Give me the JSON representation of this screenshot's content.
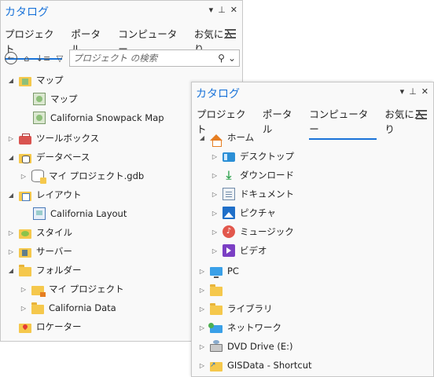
{
  "paneA": {
    "title": "カタログ",
    "header_icons": [
      "▾",
      "📌",
      "✕"
    ],
    "tabs": [
      {
        "label": "プロジェクト",
        "active": true
      },
      {
        "label": "ポータル",
        "active": false
      },
      {
        "label": "コンピューター",
        "active": false
      },
      {
        "label": "お気に入り",
        "active": false
      }
    ],
    "search": {
      "placeholder": "プロジェクト の検索"
    },
    "tree": [
      {
        "label": "マップ",
        "icon": "map-folder-icon",
        "expanded": true,
        "children": [
          {
            "label": "マップ",
            "icon": "map-icon"
          },
          {
            "label": "California Snowpack Map",
            "icon": "map-icon"
          }
        ]
      },
      {
        "label": "ツールボックス",
        "icon": "toolbox-icon",
        "expanded": false
      },
      {
        "label": "データベース",
        "icon": "database-folder-icon",
        "expanded": true,
        "children": [
          {
            "label": "マイ プロジェクト.gdb",
            "icon": "geodatabase-icon",
            "expandable": true
          }
        ]
      },
      {
        "label": "レイアウト",
        "icon": "layout-folder-icon",
        "expanded": true,
        "children": [
          {
            "label": "California Layout",
            "icon": "layout-icon"
          }
        ]
      },
      {
        "label": "スタイル",
        "icon": "style-folder-icon",
        "expanded": false
      },
      {
        "label": "サーバー",
        "icon": "server-folder-icon",
        "expanded": false
      },
      {
        "label": "フォルダー",
        "icon": "folder-icon",
        "expanded": true,
        "children": [
          {
            "label": "マイ プロジェクト",
            "icon": "home-folder-icon",
            "expandable": true
          },
          {
            "label": "California Data",
            "icon": "folder-icon",
            "expandable": true
          }
        ]
      },
      {
        "label": "ロケーター",
        "icon": "locator-folder-icon",
        "expanded": false
      }
    ]
  },
  "paneB": {
    "title": "カタログ",
    "header_icons": [
      "▾",
      "📌",
      "✕"
    ],
    "tabs": [
      {
        "label": "プロジェクト",
        "active": false
      },
      {
        "label": "ポータル",
        "active": false
      },
      {
        "label": "コンピューター",
        "active": true
      },
      {
        "label": "お気に入り",
        "active": false
      }
    ],
    "tree": [
      {
        "label": "ホーム",
        "icon": "home-icon",
        "expanded": true,
        "children": [
          {
            "label": "デスクトップ",
            "icon": "desktop-icon"
          },
          {
            "label": "ダウンロード",
            "icon": "download-icon"
          },
          {
            "label": "ドキュメント",
            "icon": "documents-icon"
          },
          {
            "label": "ピクチャ",
            "icon": "pictures-icon"
          },
          {
            "label": "ミュージック",
            "icon": "music-icon"
          },
          {
            "label": "ビデオ",
            "icon": "video-icon"
          }
        ]
      },
      {
        "label": "PC",
        "icon": "pc-icon",
        "expanded": false
      },
      {
        "label": "",
        "icon": "folder-icon",
        "expanded": false
      },
      {
        "label": "ライブラリ",
        "icon": "library-folder-icon",
        "expanded": false
      },
      {
        "label": "ネットワーク",
        "icon": "network-icon",
        "expanded": false
      },
      {
        "label": "DVD Drive (E:)",
        "icon": "dvd-drive-icon",
        "expanded": false
      },
      {
        "label": "GISData - Shortcut",
        "icon": "folder-shortcut-icon",
        "expanded": false
      }
    ]
  }
}
